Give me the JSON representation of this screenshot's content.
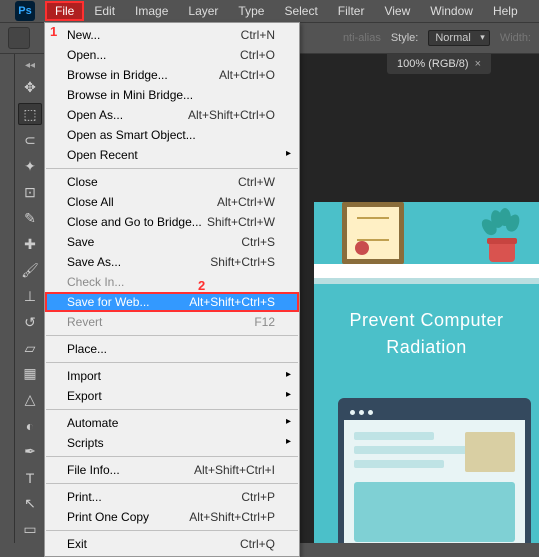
{
  "app": {
    "icon_text": "Ps"
  },
  "menubar": [
    "File",
    "Edit",
    "Image",
    "Layer",
    "Type",
    "Select",
    "Filter",
    "View",
    "Window",
    "Help"
  ],
  "menubar_active_index": 0,
  "options": {
    "anti_alias": "nti-alias",
    "style_label": "Style:",
    "style_value": "Normal",
    "width_label": "Width:"
  },
  "doc_tab": {
    "label": "100% (RGB/8)",
    "close": "×"
  },
  "tools": [
    "move",
    "marquee",
    "lasso",
    "wand",
    "crop",
    "eyedropper",
    "heal",
    "brush",
    "stamp",
    "history",
    "eraser",
    "gradient",
    "blur",
    "dodge",
    "pen",
    "type",
    "path",
    "rect"
  ],
  "dropdown": [
    {
      "type": "item",
      "label": "New...",
      "shortcut": "Ctrl+N"
    },
    {
      "type": "item",
      "label": "Open...",
      "shortcut": "Ctrl+O"
    },
    {
      "type": "item",
      "label": "Browse in Bridge...",
      "shortcut": "Alt+Ctrl+O"
    },
    {
      "type": "item",
      "label": "Browse in Mini Bridge..."
    },
    {
      "type": "item",
      "label": "Open As...",
      "shortcut": "Alt+Shift+Ctrl+O"
    },
    {
      "type": "item",
      "label": "Open as Smart Object..."
    },
    {
      "type": "sub",
      "label": "Open Recent"
    },
    {
      "type": "sep"
    },
    {
      "type": "item",
      "label": "Close",
      "shortcut": "Ctrl+W"
    },
    {
      "type": "item",
      "label": "Close All",
      "shortcut": "Alt+Ctrl+W"
    },
    {
      "type": "item",
      "label": "Close and Go to Bridge...",
      "shortcut": "Shift+Ctrl+W"
    },
    {
      "type": "item",
      "label": "Save",
      "shortcut": "Ctrl+S"
    },
    {
      "type": "item",
      "label": "Save As...",
      "shortcut": "Shift+Ctrl+S"
    },
    {
      "type": "item",
      "label": "Check In...",
      "disabled": true
    },
    {
      "type": "item",
      "label": "Save for Web...",
      "shortcut": "Alt+Shift+Ctrl+S",
      "highlight": true
    },
    {
      "type": "item",
      "label": "Revert",
      "shortcut": "F12",
      "disabled": true
    },
    {
      "type": "sep"
    },
    {
      "type": "item",
      "label": "Place..."
    },
    {
      "type": "sep"
    },
    {
      "type": "sub",
      "label": "Import"
    },
    {
      "type": "sub",
      "label": "Export"
    },
    {
      "type": "sep"
    },
    {
      "type": "sub",
      "label": "Automate"
    },
    {
      "type": "sub",
      "label": "Scripts"
    },
    {
      "type": "sep"
    },
    {
      "type": "item",
      "label": "File Info...",
      "shortcut": "Alt+Shift+Ctrl+I"
    },
    {
      "type": "sep"
    },
    {
      "type": "item",
      "label": "Print...",
      "shortcut": "Ctrl+P"
    },
    {
      "type": "item",
      "label": "Print One Copy",
      "shortcut": "Alt+Shift+Ctrl+P"
    },
    {
      "type": "sep"
    },
    {
      "type": "item",
      "label": "Exit",
      "shortcut": "Ctrl+Q"
    }
  ],
  "annotations": {
    "one": "1",
    "two": "2"
  },
  "canvas": {
    "headline1": "Prevent Computer",
    "headline2": "Radiation"
  }
}
